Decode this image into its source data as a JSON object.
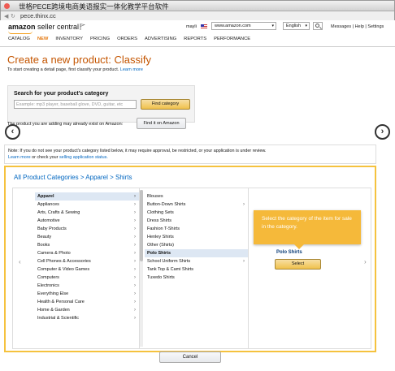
{
  "window": {
    "title": "世格PECE跨境电商美语报实一体化教学平台软件"
  },
  "browser": {
    "url": "pece.thinx.cc"
  },
  "header": {
    "logo_brand": "amazon",
    "logo_suffix": " seller central",
    "user": "mayli",
    "marketplace": "www.amazon.com",
    "language": "English",
    "messages_label": "Messages",
    "help_label": "Help",
    "settings_label": "Settings",
    "separator": "|"
  },
  "nav": {
    "items": [
      "CATALOG",
      "NEW",
      "INVENTORY",
      "PRICING",
      "ORDERS",
      "ADVERTISING",
      "REPORTS",
      "PERFORMANCE"
    ],
    "active": "NEW"
  },
  "page": {
    "title": "Create a new product: Classify",
    "intro": "To start creating a detail page, first classify your product.",
    "learn_more": "Learn more"
  },
  "search": {
    "label": "Search for your product's category",
    "placeholder": "Example: mp3 player, baseball glove, DVD, guitar, etc",
    "find_button": "Find category",
    "exists_label": "The product you are adding may already exist on Amazon:",
    "find_on_amazon_button": "Find it on Amazon"
  },
  "notice": {
    "line1": "Note: If you do not see your product's category listed below, it may require approval, be restricted, or your application is under review.",
    "learn_more": "Learn more",
    "check_text": "or check your",
    "status_link": "selling application status."
  },
  "browser_nav": {
    "prev": "‹",
    "next": "›",
    "inner_prev": "‹",
    "inner_next": "›"
  },
  "breadcrumb": [
    "All Product Categories",
    ">",
    "Apparel",
    ">",
    "Shirts"
  ],
  "columns": {
    "col1": [
      {
        "label": "Apparel",
        "selected": true,
        "arrow": true
      },
      {
        "label": "Appliances",
        "arrow": true
      },
      {
        "label": "Arts, Crafts & Sewing",
        "arrow": true
      },
      {
        "label": "Automotive",
        "arrow": true
      },
      {
        "label": "Baby Products",
        "arrow": true
      },
      {
        "label": "Beauty",
        "arrow": true
      },
      {
        "label": "Books",
        "arrow": true
      },
      {
        "label": "Camera & Photo",
        "arrow": true
      },
      {
        "label": "Cell Phones & Accessories",
        "arrow": true
      },
      {
        "label": "Computer & Video Games",
        "arrow": true
      },
      {
        "label": "Computers",
        "arrow": true
      },
      {
        "label": "Electronics",
        "arrow": true
      },
      {
        "label": "Everything Else",
        "arrow": true
      },
      {
        "label": "Health & Personal Care",
        "arrow": true
      },
      {
        "label": "Home & Garden",
        "arrow": true
      },
      {
        "label": "Industrial & Scientific",
        "arrow": true
      }
    ],
    "col2": [
      {
        "label": "Blouses"
      },
      {
        "label": "Button-Down Shirts",
        "arrow": true
      },
      {
        "label": "Clothing Sets"
      },
      {
        "label": "Dress Shirts"
      },
      {
        "label": "Fashion T-Shirts"
      },
      {
        "label": "Henley Shirts"
      },
      {
        "label": "Other (Shirts)"
      },
      {
        "label": "Polo Shirts",
        "selected": true
      },
      {
        "label": "School Uniform Shirts",
        "arrow": true
      },
      {
        "label": "Tank Top & Cami Shirts"
      },
      {
        "label": "Tuxedo Shirts"
      }
    ]
  },
  "result": {
    "title": "Polo Shirts",
    "select_button": "Select"
  },
  "callout": {
    "text": "Select the category of the item for sale in the category."
  },
  "footer": {
    "cancel_button": "Cancel"
  },
  "colors": {
    "accent": "#e47911",
    "title": "#c45500",
    "link": "#0066c0",
    "highlight": "#f5c23e"
  }
}
